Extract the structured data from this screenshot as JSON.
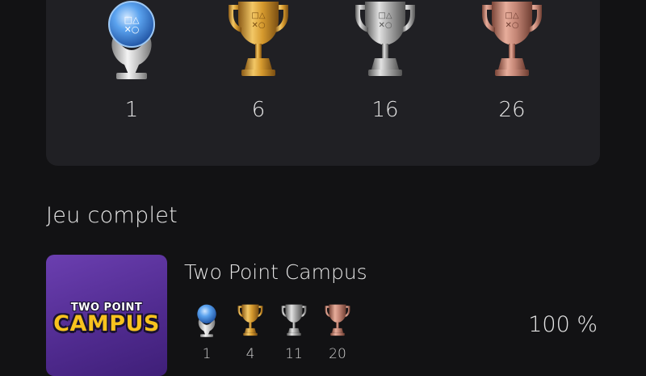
{
  "summary": {
    "trophies": [
      {
        "type": "platinum",
        "count": "1"
      },
      {
        "type": "gold",
        "count": "6"
      },
      {
        "type": "silver",
        "count": "16"
      },
      {
        "type": "bronze",
        "count": "26"
      }
    ]
  },
  "section": {
    "title": "Jeu complet"
  },
  "game": {
    "title": "Two Point Campus",
    "art": {
      "logo_top": "TWO POINT",
      "logo_main": "CAMPUS"
    },
    "trophies": [
      {
        "type": "platinum",
        "count": "1"
      },
      {
        "type": "gold",
        "count": "4"
      },
      {
        "type": "silver",
        "count": "11"
      },
      {
        "type": "bronze",
        "count": "20"
      }
    ],
    "progress": "100 %"
  },
  "colors": {
    "background": "#121214",
    "card": "#202024",
    "gold": "#e2a838",
    "silver": "#b9b9b9",
    "bronze": "#c98a78",
    "platinum": "#3d7fd6",
    "art_purple": "#5a32a0",
    "logo_yellow": "#f7c21e"
  }
}
